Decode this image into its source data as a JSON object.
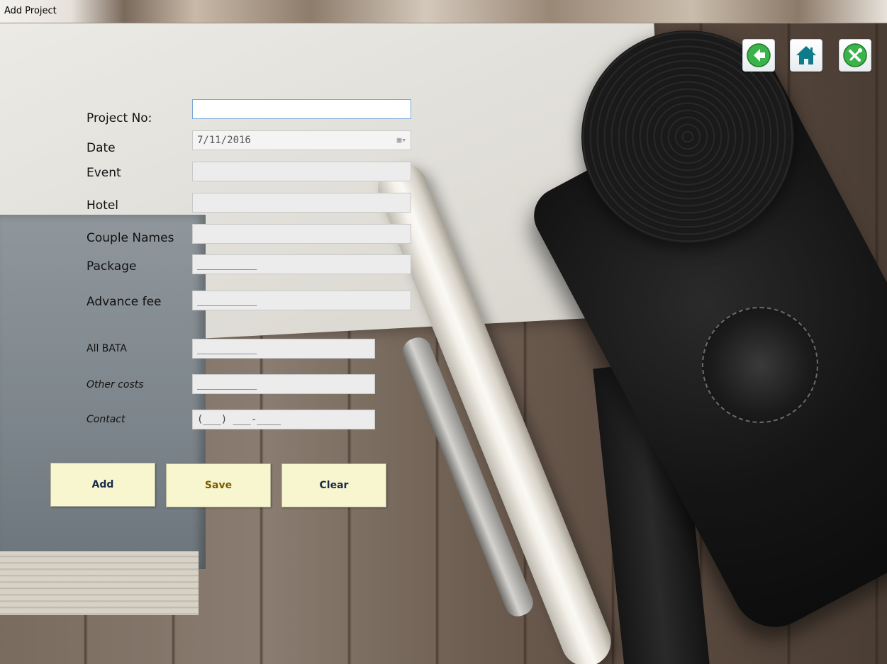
{
  "window": {
    "title": "Add Project"
  },
  "toolbar": {
    "back_icon": "arrow-left-icon",
    "home_icon": "home-icon",
    "tools_icon": "tools-icon",
    "colors": {
      "back": "#3bb34a",
      "home": "#0f7a8a",
      "tools": "#3bb34a"
    }
  },
  "form": {
    "project_no": {
      "label": "Project No:",
      "value": ""
    },
    "date": {
      "label": "Date",
      "value": "7/11/2016"
    },
    "event": {
      "label": "Event",
      "value": ""
    },
    "hotel": {
      "label": "Hotel",
      "value": ""
    },
    "couple_names": {
      "label": "Couple Names",
      "value": ""
    },
    "package": {
      "label": "Package",
      "mask": "__________"
    },
    "advance_fee": {
      "label": "Advance fee",
      "mask": "__________"
    },
    "all_bata": {
      "label": "All BATA",
      "mask": "__________"
    },
    "other_costs": {
      "label": "Other costs",
      "mask": "__________"
    },
    "contact": {
      "label": "Contact",
      "mask": "(___) ___-____"
    }
  },
  "buttons": {
    "add": "Add",
    "save": "Save",
    "clear": "Clear",
    "save_color": "#7a5a00",
    "text_color": "#1a2a4a"
  }
}
